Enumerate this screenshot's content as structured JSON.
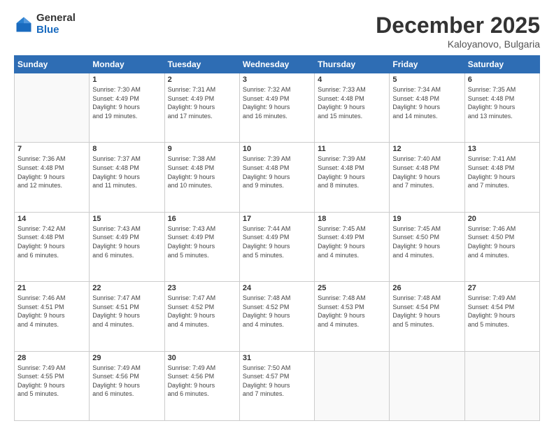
{
  "header": {
    "logo_general": "General",
    "logo_blue": "Blue",
    "month_title": "December 2025",
    "location": "Kaloyanovo, Bulgaria"
  },
  "days_of_week": [
    "Sunday",
    "Monday",
    "Tuesday",
    "Wednesday",
    "Thursday",
    "Friday",
    "Saturday"
  ],
  "weeks": [
    [
      {
        "num": "",
        "info": ""
      },
      {
        "num": "1",
        "info": "Sunrise: 7:30 AM\nSunset: 4:49 PM\nDaylight: 9 hours\nand 19 minutes."
      },
      {
        "num": "2",
        "info": "Sunrise: 7:31 AM\nSunset: 4:49 PM\nDaylight: 9 hours\nand 17 minutes."
      },
      {
        "num": "3",
        "info": "Sunrise: 7:32 AM\nSunset: 4:49 PM\nDaylight: 9 hours\nand 16 minutes."
      },
      {
        "num": "4",
        "info": "Sunrise: 7:33 AM\nSunset: 4:48 PM\nDaylight: 9 hours\nand 15 minutes."
      },
      {
        "num": "5",
        "info": "Sunrise: 7:34 AM\nSunset: 4:48 PM\nDaylight: 9 hours\nand 14 minutes."
      },
      {
        "num": "6",
        "info": "Sunrise: 7:35 AM\nSunset: 4:48 PM\nDaylight: 9 hours\nand 13 minutes."
      }
    ],
    [
      {
        "num": "7",
        "info": "Sunrise: 7:36 AM\nSunset: 4:48 PM\nDaylight: 9 hours\nand 12 minutes."
      },
      {
        "num": "8",
        "info": "Sunrise: 7:37 AM\nSunset: 4:48 PM\nDaylight: 9 hours\nand 11 minutes."
      },
      {
        "num": "9",
        "info": "Sunrise: 7:38 AM\nSunset: 4:48 PM\nDaylight: 9 hours\nand 10 minutes."
      },
      {
        "num": "10",
        "info": "Sunrise: 7:39 AM\nSunset: 4:48 PM\nDaylight: 9 hours\nand 9 minutes."
      },
      {
        "num": "11",
        "info": "Sunrise: 7:39 AM\nSunset: 4:48 PM\nDaylight: 9 hours\nand 8 minutes."
      },
      {
        "num": "12",
        "info": "Sunrise: 7:40 AM\nSunset: 4:48 PM\nDaylight: 9 hours\nand 7 minutes."
      },
      {
        "num": "13",
        "info": "Sunrise: 7:41 AM\nSunset: 4:48 PM\nDaylight: 9 hours\nand 7 minutes."
      }
    ],
    [
      {
        "num": "14",
        "info": "Sunrise: 7:42 AM\nSunset: 4:48 PM\nDaylight: 9 hours\nand 6 minutes."
      },
      {
        "num": "15",
        "info": "Sunrise: 7:43 AM\nSunset: 4:49 PM\nDaylight: 9 hours\nand 6 minutes."
      },
      {
        "num": "16",
        "info": "Sunrise: 7:43 AM\nSunset: 4:49 PM\nDaylight: 9 hours\nand 5 minutes."
      },
      {
        "num": "17",
        "info": "Sunrise: 7:44 AM\nSunset: 4:49 PM\nDaylight: 9 hours\nand 5 minutes."
      },
      {
        "num": "18",
        "info": "Sunrise: 7:45 AM\nSunset: 4:49 PM\nDaylight: 9 hours\nand 4 minutes."
      },
      {
        "num": "19",
        "info": "Sunrise: 7:45 AM\nSunset: 4:50 PM\nDaylight: 9 hours\nand 4 minutes."
      },
      {
        "num": "20",
        "info": "Sunrise: 7:46 AM\nSunset: 4:50 PM\nDaylight: 9 hours\nand 4 minutes."
      }
    ],
    [
      {
        "num": "21",
        "info": "Sunrise: 7:46 AM\nSunset: 4:51 PM\nDaylight: 9 hours\nand 4 minutes."
      },
      {
        "num": "22",
        "info": "Sunrise: 7:47 AM\nSunset: 4:51 PM\nDaylight: 9 hours\nand 4 minutes."
      },
      {
        "num": "23",
        "info": "Sunrise: 7:47 AM\nSunset: 4:52 PM\nDaylight: 9 hours\nand 4 minutes."
      },
      {
        "num": "24",
        "info": "Sunrise: 7:48 AM\nSunset: 4:52 PM\nDaylight: 9 hours\nand 4 minutes."
      },
      {
        "num": "25",
        "info": "Sunrise: 7:48 AM\nSunset: 4:53 PM\nDaylight: 9 hours\nand 4 minutes."
      },
      {
        "num": "26",
        "info": "Sunrise: 7:48 AM\nSunset: 4:54 PM\nDaylight: 9 hours\nand 5 minutes."
      },
      {
        "num": "27",
        "info": "Sunrise: 7:49 AM\nSunset: 4:54 PM\nDaylight: 9 hours\nand 5 minutes."
      }
    ],
    [
      {
        "num": "28",
        "info": "Sunrise: 7:49 AM\nSunset: 4:55 PM\nDaylight: 9 hours\nand 5 minutes."
      },
      {
        "num": "29",
        "info": "Sunrise: 7:49 AM\nSunset: 4:56 PM\nDaylight: 9 hours\nand 6 minutes."
      },
      {
        "num": "30",
        "info": "Sunrise: 7:49 AM\nSunset: 4:56 PM\nDaylight: 9 hours\nand 6 minutes."
      },
      {
        "num": "31",
        "info": "Sunrise: 7:50 AM\nSunset: 4:57 PM\nDaylight: 9 hours\nand 7 minutes."
      },
      {
        "num": "",
        "info": ""
      },
      {
        "num": "",
        "info": ""
      },
      {
        "num": "",
        "info": ""
      }
    ]
  ]
}
